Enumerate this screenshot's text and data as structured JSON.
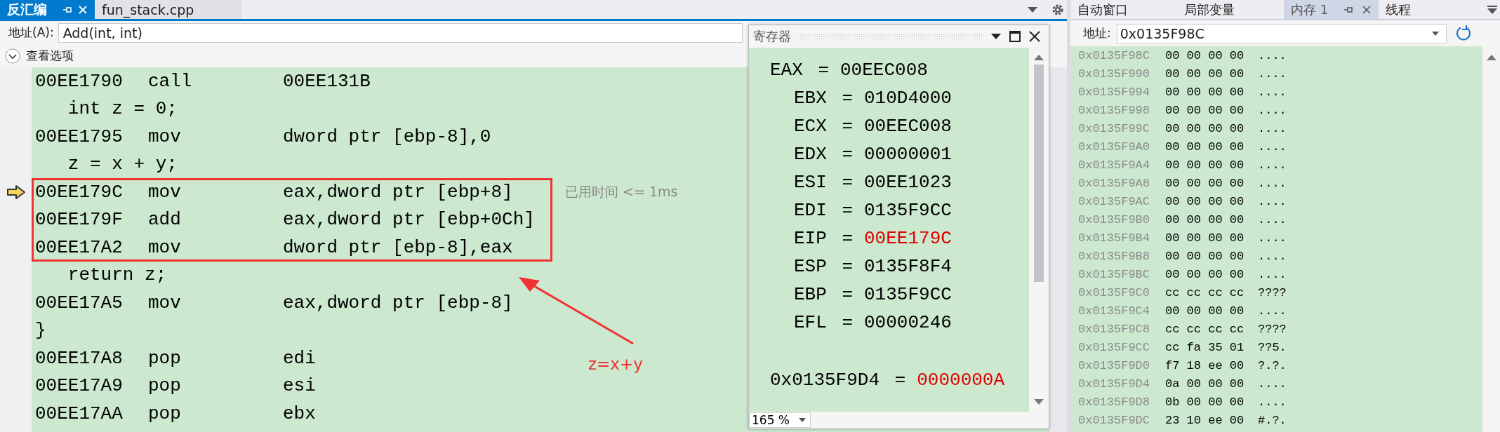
{
  "disassembly": {
    "tabs": [
      {
        "label": "反汇编",
        "selected": true
      },
      {
        "label": "fun_stack.cpp",
        "selected": false
      }
    ],
    "address_label": "地址(A):",
    "address": "Add(int, int)",
    "view_options": "查看选项",
    "lines": [
      {
        "kind": "asm",
        "address": "00EE1790",
        "mnemonic": "call",
        "operands": "00EE131B",
        "current": false,
        "boxed": false
      },
      {
        "kind": "source",
        "text": "   int z = 0;"
      },
      {
        "kind": "asm",
        "address": "00EE1795",
        "mnemonic": "mov",
        "operands": "dword ptr [ebp-8],0",
        "current": false,
        "boxed": false
      },
      {
        "kind": "source",
        "text": "   z = x + y;"
      },
      {
        "kind": "asm",
        "address": "00EE179C",
        "mnemonic": "mov",
        "operands": "eax,dword ptr [ebp+8]",
        "current": true,
        "boxed": true,
        "note": "已用时间 <= 1ms"
      },
      {
        "kind": "asm",
        "address": "00EE179F",
        "mnemonic": "add",
        "operands": "eax,dword ptr [ebp+0Ch]",
        "current": false,
        "boxed": true
      },
      {
        "kind": "asm",
        "address": "00EE17A2",
        "mnemonic": "mov",
        "operands": "dword ptr [ebp-8],eax",
        "current": false,
        "boxed": true
      },
      {
        "kind": "source",
        "text": "   return z;"
      },
      {
        "kind": "asm",
        "address": "00EE17A5",
        "mnemonic": "mov",
        "operands": "eax,dword ptr [ebp-8]",
        "current": false,
        "boxed": false
      },
      {
        "kind": "source",
        "text": "}"
      },
      {
        "kind": "asm",
        "address": "00EE17A8",
        "mnemonic": "pop",
        "operands": "edi",
        "current": false,
        "boxed": false
      },
      {
        "kind": "asm",
        "address": "00EE17A9",
        "mnemonic": "pop",
        "operands": "esi",
        "current": false,
        "boxed": false
      },
      {
        "kind": "asm",
        "address": "00EE17AA",
        "mnemonic": "pop",
        "operands": "ebx",
        "current": false,
        "boxed": false
      }
    ],
    "annotation": {
      "label": "z=x+y"
    }
  },
  "registers_window": {
    "title": "寄存器",
    "registers": [
      {
        "name": "EAX =",
        "value": "00EEC008",
        "changed": false
      },
      {
        "name": "EBX =",
        "value": "010D4000",
        "changed": false
      },
      {
        "name": "ECX =",
        "value": "00EEC008",
        "changed": false
      },
      {
        "name": "EDX =",
        "value": "00000001",
        "changed": false
      },
      {
        "name": "ESI =",
        "value": "00EE1023",
        "changed": false
      },
      {
        "name": "EDI =",
        "value": "0135F9CC",
        "changed": false
      },
      {
        "name": "EIP =",
        "value": "00EE179C",
        "changed": true
      },
      {
        "name": "ESP =",
        "value": "0135F8F4",
        "changed": false
      },
      {
        "name": "EBP =",
        "value": "0135F9CC",
        "changed": false
      },
      {
        "name": "EFL =",
        "value": "00000246",
        "changed": false
      }
    ],
    "watch": {
      "name": "0x0135F9D4 =",
      "value": "0000000A",
      "changed": true
    },
    "zoom": "165 %"
  },
  "memory": {
    "tabs": [
      {
        "label": "自动窗口",
        "selected": false
      },
      {
        "label": "局部变量",
        "selected": false
      },
      {
        "label": "内存 1",
        "selected": true
      },
      {
        "label": "线程",
        "selected": false
      }
    ],
    "address_label": "地址:",
    "address": "0x0135F98C",
    "rows": [
      {
        "address": "0x0135F98C",
        "bytes": "00 00 00 00",
        "ascii": "...."
      },
      {
        "address": "0x0135F990",
        "bytes": "00 00 00 00",
        "ascii": "...."
      },
      {
        "address": "0x0135F994",
        "bytes": "00 00 00 00",
        "ascii": "...."
      },
      {
        "address": "0x0135F998",
        "bytes": "00 00 00 00",
        "ascii": "...."
      },
      {
        "address": "0x0135F99C",
        "bytes": "00 00 00 00",
        "ascii": "...."
      },
      {
        "address": "0x0135F9A0",
        "bytes": "00 00 00 00",
        "ascii": "...."
      },
      {
        "address": "0x0135F9A4",
        "bytes": "00 00 00 00",
        "ascii": "...."
      },
      {
        "address": "0x0135F9A8",
        "bytes": "00 00 00 00",
        "ascii": "...."
      },
      {
        "address": "0x0135F9AC",
        "bytes": "00 00 00 00",
        "ascii": "...."
      },
      {
        "address": "0x0135F9B0",
        "bytes": "00 00 00 00",
        "ascii": "...."
      },
      {
        "address": "0x0135F9B4",
        "bytes": "00 00 00 00",
        "ascii": "...."
      },
      {
        "address": "0x0135F9B8",
        "bytes": "00 00 00 00",
        "ascii": "...."
      },
      {
        "address": "0x0135F9BC",
        "bytes": "00 00 00 00",
        "ascii": "...."
      },
      {
        "address": "0x0135F9C0",
        "bytes": "cc cc cc cc",
        "ascii": "????"
      },
      {
        "address": "0x0135F9C4",
        "bytes": "00 00 00 00",
        "ascii": "...."
      },
      {
        "address": "0x0135F9C8",
        "bytes": "cc cc cc cc",
        "ascii": "????"
      },
      {
        "address": "0x0135F9CC",
        "bytes": "cc fa 35 01",
        "ascii": "??5."
      },
      {
        "address": "0x0135F9D0",
        "bytes": "f7 18 ee 00",
        "ascii": "?.?."
      },
      {
        "address": "0x0135F9D4",
        "bytes": "0a 00 00 00",
        "ascii": "...."
      },
      {
        "address": "0x0135F9D8",
        "bytes": "0b 00 00 00",
        "ascii": "...."
      },
      {
        "address": "0x0135F9DC",
        "bytes": "23 10 ee 00",
        "ascii": "#.?."
      }
    ]
  }
}
